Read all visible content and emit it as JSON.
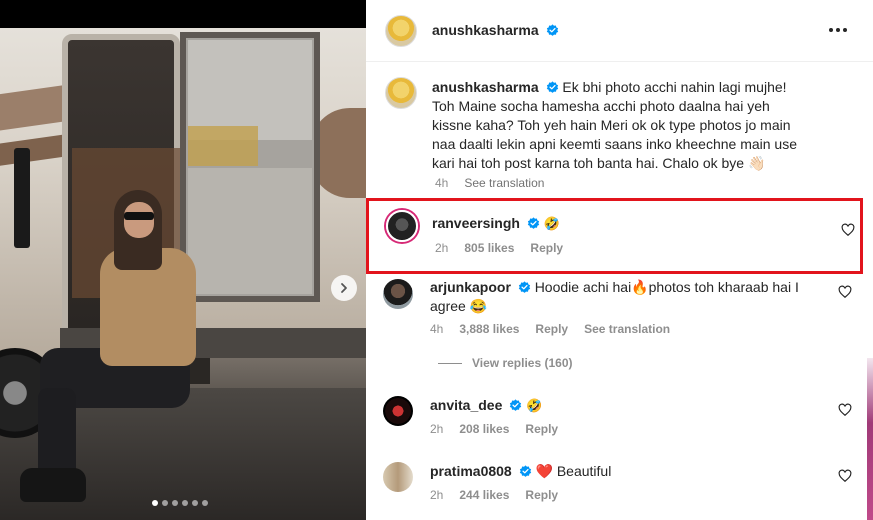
{
  "post": {
    "carousel": {
      "dot_count": 6,
      "active_index": 0
    },
    "next_icon": "chevron-right-icon"
  },
  "header": {
    "username": "anushkasharma",
    "verified_icon": "verified-badge-icon",
    "more_icon": "more-horizontal-icon"
  },
  "caption": {
    "username": "anushkasharma",
    "text": "Ek bhi photo acchi nahin lagi mujhe! Toh Maine socha hamesha acchi photo daalna hai yeh kissne kaha? Toh yeh hain Meri ok ok type photos jo main naa daalti lekin apni keemti saans inko kheechne main use kari hai toh post karna toh banta hai. Chalo ok bye 👋🏻",
    "time": "4h",
    "see_translation": "See translation"
  },
  "comments": [
    {
      "username": "ranveersingh",
      "text": "🤣",
      "time": "2h",
      "likes": "805 likes",
      "reply": "Reply",
      "highlighted": true
    },
    {
      "username": "arjunkapoor",
      "text": "Hoodie achi hai🔥photos toh kharaab hai I agree 😂",
      "time": "4h",
      "likes": "3,888 likes",
      "reply": "Reply",
      "see_translation": "See translation",
      "view_replies": "View replies (160)"
    },
    {
      "username": "anvita_dee",
      "text": "🤣",
      "time": "2h",
      "likes": "208 likes",
      "reply": "Reply"
    },
    {
      "username": "pratima0808",
      "text": "❤️ Beautiful",
      "time": "2h",
      "likes": "244 likes",
      "reply": "Reply"
    }
  ],
  "colors": {
    "verified_blue": "#0095f6",
    "highlight_red": "#e2141c",
    "meta_gray": "#8e8e8e"
  }
}
